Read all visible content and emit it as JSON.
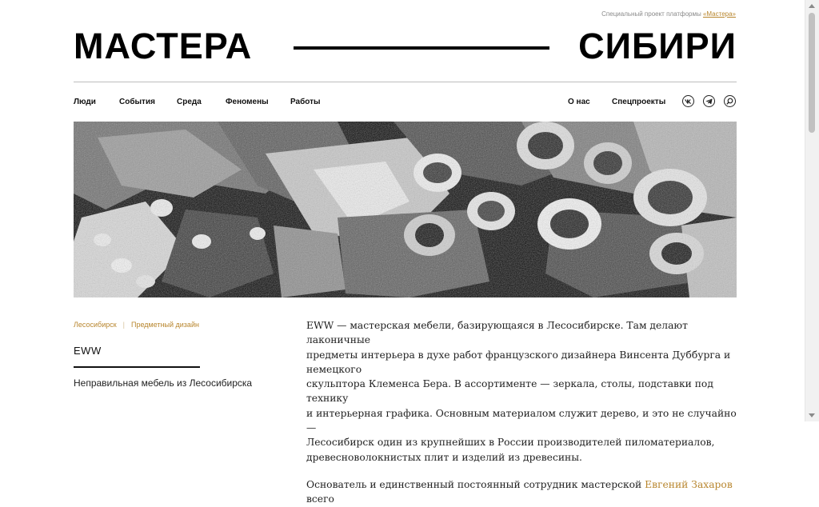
{
  "header": {
    "project_note": "Специальный проект платформы",
    "project_link": "«Мастера»",
    "logo_left": "МАСТЕРА",
    "logo_right": "СИБИРИ"
  },
  "nav": {
    "left": [
      "Люди",
      "События",
      "Среда",
      "Феномены",
      "Работы"
    ],
    "right": [
      "О нас",
      "Спецпроекты"
    ],
    "icons": [
      "vk-icon",
      "telegram-icon",
      "search-icon"
    ]
  },
  "article": {
    "tags": [
      "Лесосибирск",
      "Предметный дизайн"
    ],
    "title": "EWW",
    "subtitle": "Неправильная мебель из Лесосибирска",
    "paragraph_1_lines": [
      "EWW — мастерская мебели, базирующаяся в Лесосибирске. Там делают лаконичные",
      "предметы интерьера в духе работ французского дизайнера Винсента Дуббурга и немецкого",
      "скульптора Клеменса Бера. В ассортименте — зеркала, столы, подставки под технику",
      "и интерьерная графика. Основным материалом служит дерево, и это не случайно —",
      "Лесосибирск один из крупнейших в России производителей пиломатериалов,",
      "древесноволокнистых плит и изделий из древесины."
    ],
    "paragraph_2_start": "Основатель и единственный постоянный сотрудник мастерской",
    "paragraph_2_link": "Евгений Захаров",
    "paragraph_2_end": "всего"
  },
  "colors": {
    "accent": "#b8862e",
    "text": "#111111",
    "hero_bg": "#0b0b0b"
  }
}
